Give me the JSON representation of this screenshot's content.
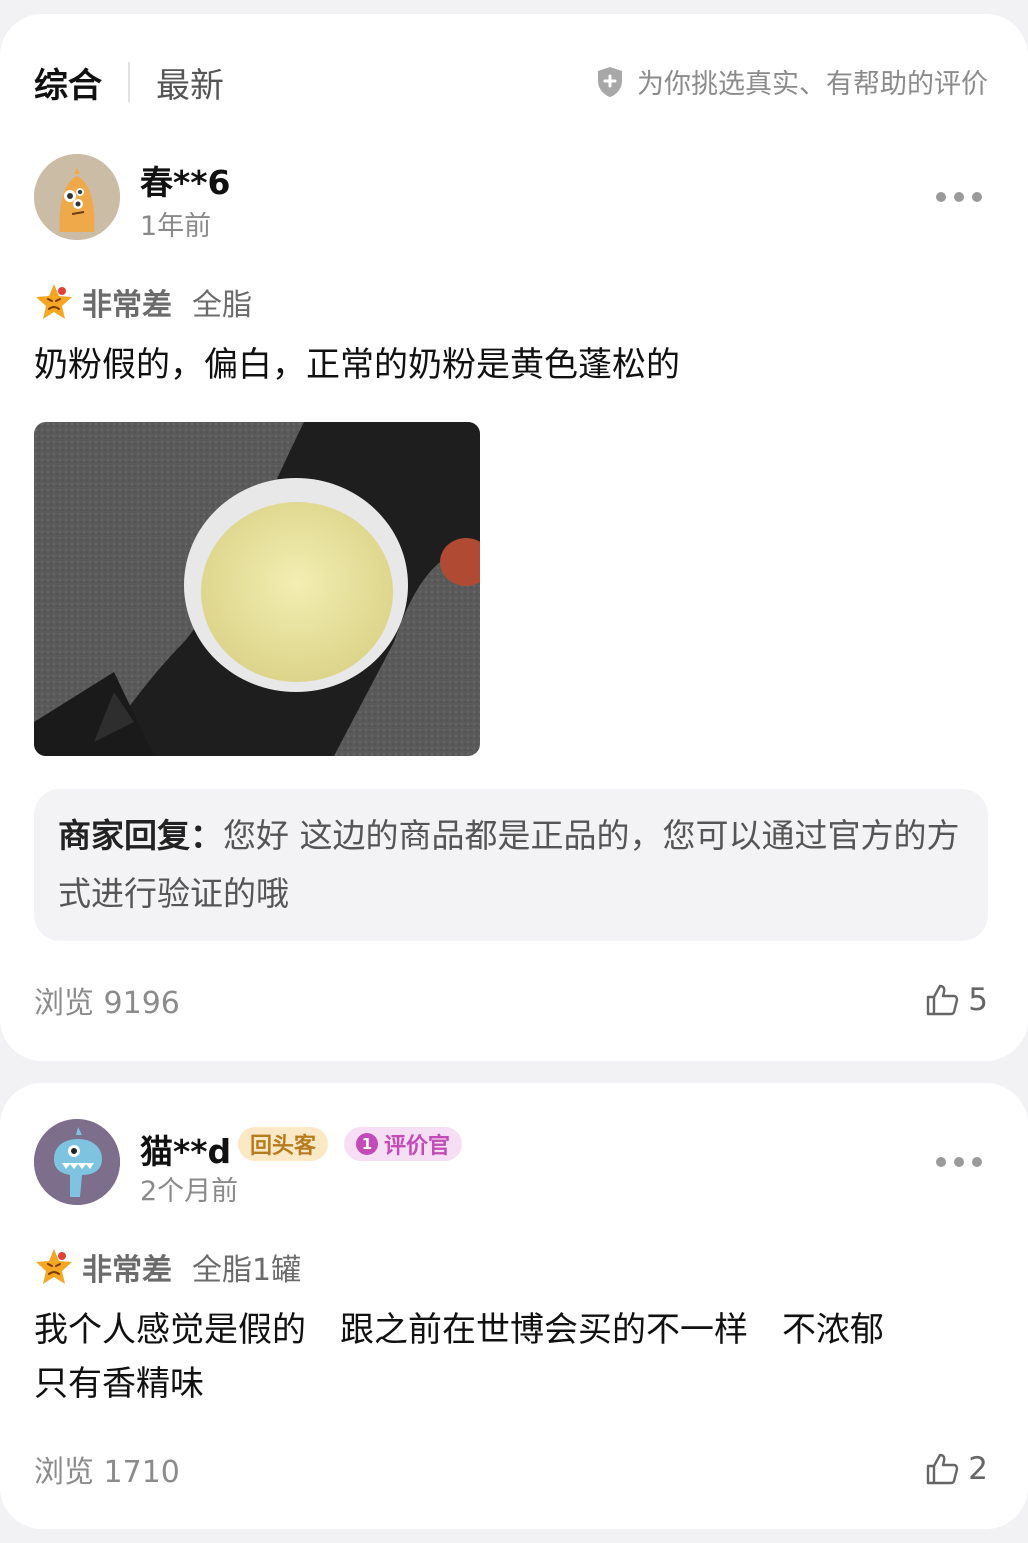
{
  "tabs": {
    "active": "综合",
    "other": "最新"
  },
  "notice": "为你挑选真实、有帮助的评价",
  "reviews": [
    {
      "username": "春**6",
      "time": "1年前",
      "rating_label": "非常差",
      "spec": "全脂",
      "content": "奶粉假的，偏白，正常的奶粉是黄色蓬松的",
      "reply_label": "商家回复：",
      "reply_text": "您好 这边的商品都是正品的，您可以通过官方的方式进行验证的哦",
      "views": "浏览 9196",
      "likes": "5"
    },
    {
      "username": "猫**d",
      "badge_returning": "回头客",
      "badge_reviewer_num": "1",
      "badge_reviewer": "评价官",
      "time": "2个月前",
      "rating_label": "非常差",
      "spec": "全脂1罐",
      "content_line1": "我个人感觉是假的　跟之前在世博会买的不一样　不浓郁",
      "content_line2": "只有香精味",
      "views": "浏览 1710",
      "likes": "2"
    }
  ],
  "colors": {
    "badge_returning": "#b77c1f",
    "badge_reviewer": "#c24bb8",
    "rating_star": "#f5a623"
  }
}
